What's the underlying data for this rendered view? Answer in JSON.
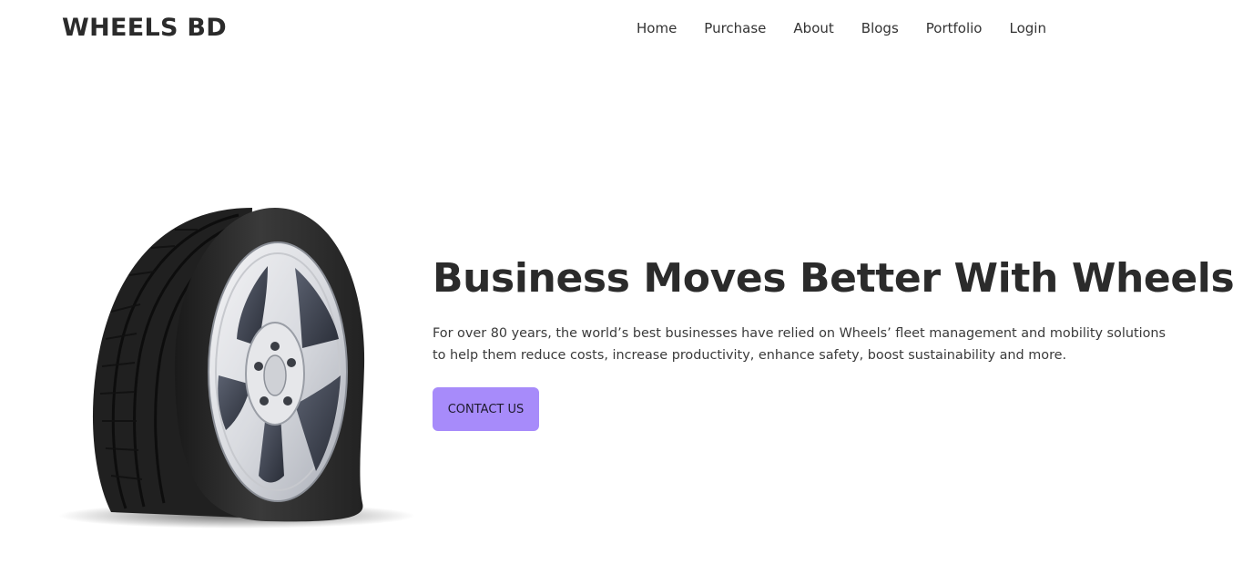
{
  "navbar": {
    "brand": "WHEELS BD",
    "links": [
      {
        "label": "Home"
      },
      {
        "label": "Purchase"
      },
      {
        "label": "About"
      },
      {
        "label": "Blogs"
      },
      {
        "label": "Portfolio"
      },
      {
        "label": "Login"
      }
    ]
  },
  "hero": {
    "title": "Business Moves Better With Wheels",
    "description": "For over 80 years, the world’s best businesses have relied on Wheels’ fleet management and mobility solutions to help them reduce costs, increase productivity, enhance safety, boost sustainability and more.",
    "cta_label": "CONTACT US",
    "image": "flat-tire-illustration"
  },
  "colors": {
    "accent": "#a78bfa",
    "text": "#2b2b2b",
    "background": "#ffffff"
  }
}
